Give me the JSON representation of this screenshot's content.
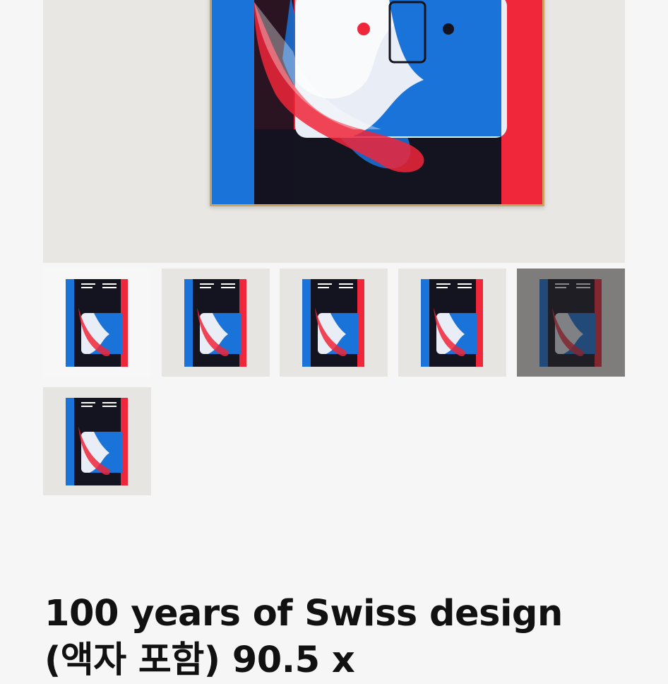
{
  "product": {
    "title": "100 years of Swiss design (액자 포함) 90.5 x"
  },
  "gallery": {
    "hero_image": "poster-framed-image",
    "thumbnail_count": 6,
    "selected_index": 4
  },
  "colors": {
    "blue": "#1a73d9",
    "red": "#f0263a",
    "black": "#141320",
    "frame": "#c9a460",
    "hero_bg": "#e9e7e3"
  }
}
